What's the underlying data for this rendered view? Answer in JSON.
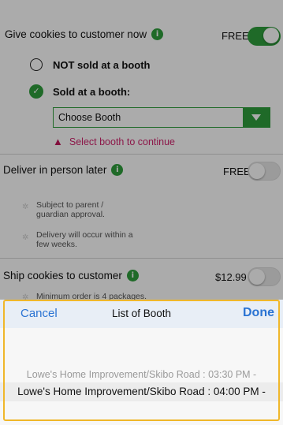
{
  "sections": {
    "give_now": {
      "label": "Give cookies to customer now",
      "price": "FREE",
      "toggle_on": true
    },
    "options": {
      "not_sold": "NOT sold at a booth",
      "sold": "Sold at a booth:",
      "select_value": "Choose Booth",
      "warning": "Select booth to continue"
    },
    "deliver_later": {
      "label": "Deliver in person later",
      "price": "FREE",
      "toggle_on": false,
      "notes": [
        "Subject to parent / guardian approval.",
        "Delivery will occur within a few weeks."
      ]
    },
    "ship": {
      "label": "Ship cookies to customer",
      "price": "$12.99",
      "toggle_on": false,
      "notes": [
        "Minimum order is 4 packages."
      ]
    }
  },
  "picker": {
    "cancel": "Cancel",
    "title": "List of Booth",
    "done": "Done",
    "options": [
      "Lowe's Home Improvement/Skibo Road : 03:30 PM -",
      "Lowe's Home Improvement/Skibo Road : 04:00 PM -"
    ],
    "selected_index": 1
  },
  "colors": {
    "accent": "#2f9e3c",
    "link": "#2a73d3",
    "warning": "#d1246e",
    "highlight_frame": "#f0b72a"
  }
}
